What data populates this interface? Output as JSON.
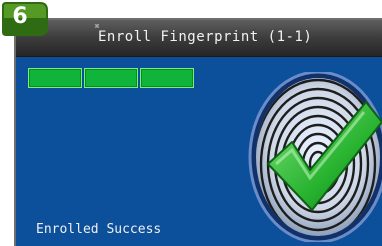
{
  "step_badge": "6",
  "title": "Enroll Fingerprint (1-1)",
  "status_text": "Enrolled Success",
  "progress": {
    "filled_segments": 3,
    "total_segments": 3
  },
  "icons": [
    "pin-icon",
    "fingerprint-icon",
    "checkmark-icon"
  ],
  "colors": {
    "screen_bg": "#0c4f9a",
    "progress": "#10b43a",
    "check": "#2fbf2f"
  }
}
